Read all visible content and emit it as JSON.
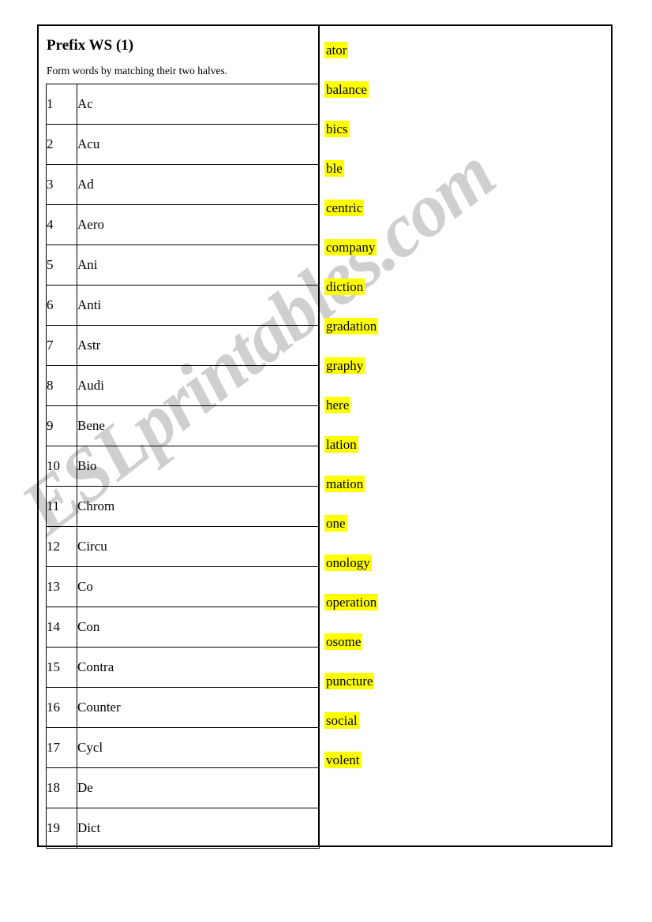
{
  "watermark": {
    "text": "ESLprintables.com",
    "color": "#cfcfcf"
  },
  "worksheet": {
    "title": "Prefix WS (1)",
    "instruction": "Form words by matching their two halves.",
    "highlight_color": "#ffff00",
    "prefix_rows": [
      {
        "number": "1",
        "prefix": "Ac"
      },
      {
        "number": "2",
        "prefix": "Acu"
      },
      {
        "number": "3",
        "prefix": "Ad"
      },
      {
        "number": "4",
        "prefix": "Aero"
      },
      {
        "number": "5",
        "prefix": "Ani"
      },
      {
        "number": "6",
        "prefix": "Anti"
      },
      {
        "number": "7",
        "prefix": "Astr"
      },
      {
        "number": "8",
        "prefix": "Audi"
      },
      {
        "number": "9",
        "prefix": "Bene"
      },
      {
        "number": "10",
        "prefix": "Bio"
      },
      {
        "number": "11",
        "prefix": "Chrom"
      },
      {
        "number": "12",
        "prefix": "Circu"
      },
      {
        "number": "13",
        "prefix": "Co"
      },
      {
        "number": "14",
        "prefix": "Con"
      },
      {
        "number": "15",
        "prefix": "Contra"
      },
      {
        "number": "16",
        "prefix": "Counter"
      },
      {
        "number": "17",
        "prefix": "Cycl"
      },
      {
        "number": "18",
        "prefix": "De"
      },
      {
        "number": "19",
        "prefix": "Dict"
      }
    ],
    "suffixes": [
      "ator",
      "balance",
      "bics",
      "ble",
      "centric",
      "company",
      "diction",
      "gradation",
      "graphy",
      "here",
      "lation",
      "mation",
      "one",
      "onology",
      "operation",
      "osome",
      "puncture",
      "social",
      "volent"
    ]
  }
}
